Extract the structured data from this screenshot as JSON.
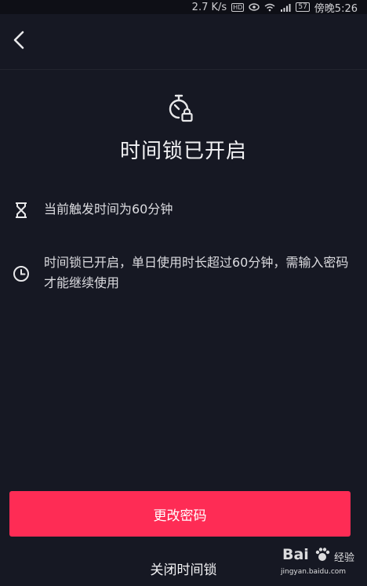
{
  "status_bar": {
    "speed": "2.7 K/s",
    "hd": "HD",
    "battery": "57",
    "time": "傍晚5:26"
  },
  "nav": {
    "back_icon": "chevron-left-icon"
  },
  "hero": {
    "icon": "timer-lock-icon",
    "title": "时间锁已开启"
  },
  "info": [
    {
      "icon": "hourglass-icon",
      "text": "当前触发时间为60分钟"
    },
    {
      "icon": "clock-icon",
      "text": "时间锁已开启，单日使用时长超过60分钟，需输入密码才能继续使用"
    }
  ],
  "actions": {
    "change_password": "更改密码",
    "close_lock": "关闭时间锁"
  },
  "watermark": {
    "brand": "Bai",
    "brand_tail": "经验",
    "url": "jingyan.baidu.com"
  },
  "colors": {
    "background": "#161823",
    "accent": "#fe2c55",
    "text": "#e8e8ea"
  }
}
